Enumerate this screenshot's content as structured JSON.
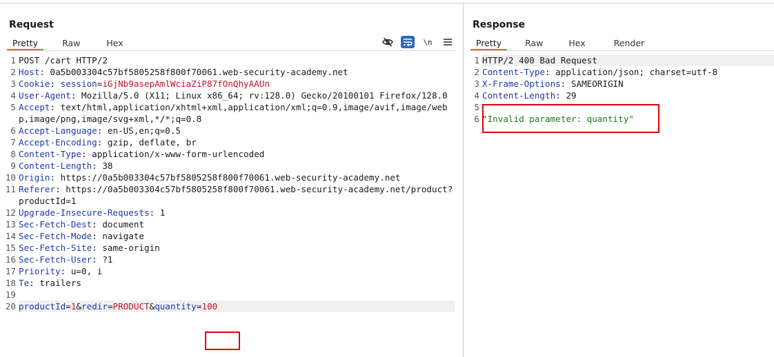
{
  "request": {
    "title": "Request",
    "tabs": [
      {
        "label": "Pretty",
        "active": true
      },
      {
        "label": "Raw",
        "active": false
      },
      {
        "label": "Hex",
        "active": false
      }
    ],
    "toolbar": {
      "hide_icon": "eye-slash-icon",
      "wrap_icon": "word-wrap-icon",
      "newline_label": "\\n",
      "menu_icon": "hamburger-menu-icon"
    },
    "lines": [
      {
        "n": "1",
        "parts": [
          {
            "t": "POST /cart HTTP/2",
            "c": "v"
          }
        ]
      },
      {
        "n": "2",
        "parts": [
          {
            "t": "Host",
            "c": "k"
          },
          {
            "t": ": 0a5b003304c57bf5805258f800f70061.web-security-academy.net",
            "c": "v"
          }
        ]
      },
      {
        "n": "3",
        "parts": [
          {
            "t": "Cookie",
            "c": "k"
          },
          {
            "t": ": ",
            "c": "v"
          },
          {
            "t": "session",
            "c": "k"
          },
          {
            "t": "=",
            "c": "v"
          },
          {
            "t": "iGjNb9asepAmlWciaZiP87fOnQhyAAUn",
            "c": "red"
          }
        ]
      },
      {
        "n": "4",
        "parts": [
          {
            "t": "User-Agent",
            "c": "k"
          },
          {
            "t": ": Mozilla/5.0 (X11; Linux x86_64; rv:128.0) Gecko/20100101 Firefox/128.0",
            "c": "v"
          }
        ]
      },
      {
        "n": "5",
        "parts": [
          {
            "t": "Accept",
            "c": "k"
          },
          {
            "t": ": text/html,application/xhtml+xml,application/xml;q=0.9,image/avif,image/webp,image/png,image/svg+xml,*/*;q=0.8",
            "c": "v"
          }
        ]
      },
      {
        "n": "6",
        "parts": [
          {
            "t": "Accept-Language",
            "c": "k"
          },
          {
            "t": ": en-US,en;q=0.5",
            "c": "v"
          }
        ]
      },
      {
        "n": "7",
        "parts": [
          {
            "t": "Accept-Encoding",
            "c": "k"
          },
          {
            "t": ": gzip, deflate, br",
            "c": "v"
          }
        ]
      },
      {
        "n": "8",
        "parts": [
          {
            "t": "Content-Type",
            "c": "k"
          },
          {
            "t": ": application/x-www-form-urlencoded",
            "c": "v"
          }
        ]
      },
      {
        "n": "9",
        "parts": [
          {
            "t": "Content-Length",
            "c": "k"
          },
          {
            "t": ": 38",
            "c": "v"
          }
        ]
      },
      {
        "n": "10",
        "parts": [
          {
            "t": "Origin",
            "c": "k"
          },
          {
            "t": ": https://0a5b003304c57bf5805258f800f70061.web-security-academy.net",
            "c": "v"
          }
        ]
      },
      {
        "n": "11",
        "parts": [
          {
            "t": "Referer",
            "c": "k"
          },
          {
            "t": ": https://0a5b003304c57bf5805258f800f70061.web-security-academy.net/product?productId=1",
            "c": "v"
          }
        ]
      },
      {
        "n": "12",
        "parts": [
          {
            "t": "Upgrade-Insecure-Requests",
            "c": "k"
          },
          {
            "t": ": 1",
            "c": "v"
          }
        ]
      },
      {
        "n": "13",
        "parts": [
          {
            "t": "Sec-Fetch-Dest",
            "c": "k"
          },
          {
            "t": ": document",
            "c": "v"
          }
        ]
      },
      {
        "n": "14",
        "parts": [
          {
            "t": "Sec-Fetch-Mode",
            "c": "k"
          },
          {
            "t": ": navigate",
            "c": "v"
          }
        ]
      },
      {
        "n": "15",
        "parts": [
          {
            "t": "Sec-Fetch-Site",
            "c": "k"
          },
          {
            "t": ": same-origin",
            "c": "v"
          }
        ]
      },
      {
        "n": "16",
        "parts": [
          {
            "t": "Sec-Fetch-User",
            "c": "k"
          },
          {
            "t": ": ?1",
            "c": "v"
          }
        ]
      },
      {
        "n": "17",
        "parts": [
          {
            "t": "Priority",
            "c": "k"
          },
          {
            "t": ": u=0, i",
            "c": "v"
          }
        ]
      },
      {
        "n": "18",
        "parts": [
          {
            "t": "Te",
            "c": "k"
          },
          {
            "t": ": trailers",
            "c": "v"
          }
        ]
      },
      {
        "n": "19",
        "parts": []
      },
      {
        "n": "20",
        "parts": [
          {
            "t": "productId",
            "c": "k"
          },
          {
            "t": "=",
            "c": "v"
          },
          {
            "t": "1",
            "c": "red"
          },
          {
            "t": "&",
            "c": "v"
          },
          {
            "t": "redir",
            "c": "k"
          },
          {
            "t": "=",
            "c": "v"
          },
          {
            "t": "PRODUCT",
            "c": "red"
          },
          {
            "t": "&",
            "c": "v"
          },
          {
            "t": "quantity",
            "c": "k"
          },
          {
            "t": "=",
            "c": "v"
          },
          {
            "t": "100",
            "c": "red"
          }
        ],
        "highlight": true
      }
    ]
  },
  "response": {
    "title": "Response",
    "tabs": [
      {
        "label": "Pretty",
        "active": true
      },
      {
        "label": "Raw",
        "active": false
      },
      {
        "label": "Hex",
        "active": false
      },
      {
        "label": "Render",
        "active": false
      }
    ],
    "lines": [
      {
        "n": "1",
        "parts": [
          {
            "t": "HTTP/2 400 Bad Request",
            "c": "v"
          }
        ],
        "highlight": true
      },
      {
        "n": "2",
        "parts": [
          {
            "t": "Content-Type",
            "c": "k"
          },
          {
            "t": ": application/json; charset=utf-8",
            "c": "v"
          }
        ]
      },
      {
        "n": "3",
        "parts": [
          {
            "t": "X-Frame-Options",
            "c": "k"
          },
          {
            "t": ": SAMEORIGIN",
            "c": "v"
          }
        ]
      },
      {
        "n": "4",
        "parts": [
          {
            "t": "Content-Length",
            "c": "k"
          },
          {
            "t": ": 29",
            "c": "v"
          }
        ]
      },
      {
        "n": "5",
        "parts": []
      },
      {
        "n": "6",
        "parts": [
          {
            "t": "\"Invalid parameter: quantity\"",
            "c": "str"
          }
        ]
      }
    ]
  },
  "colors": {
    "header_key": "#1e39a8",
    "value_red": "#c8102e",
    "string_green": "#1d7a1d",
    "active_tab_underline": "#e8622a",
    "annotation_box": "#e0000a"
  }
}
